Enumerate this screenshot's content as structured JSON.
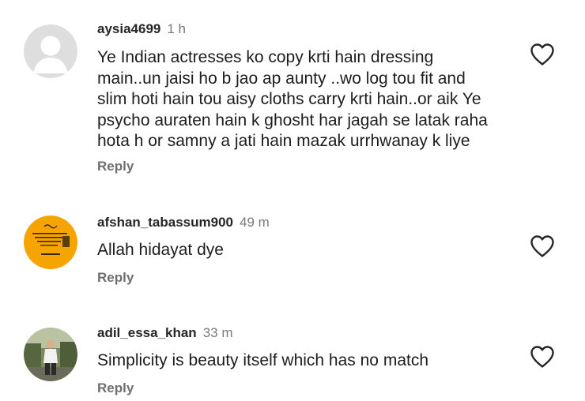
{
  "comments": [
    {
      "username": "aysia4699",
      "time": "1 h",
      "text_lines": [
        "Ye Indian actresses ko copy krti hain dressing",
        "main..un jaisi ho b jao ap aunty ..wo log tou fit and",
        "slim hoti hain tou aisy cloths carry krti hain..or aik Ye",
        "psycho auraten hain k ghosht har jagah se latak raha",
        "hota h or samny a jati hain mazak urrhwanay k liye"
      ],
      "reply_label": "Reply",
      "avatar_icon": "default-user-icon",
      "like_icon": "heart-outline-icon"
    },
    {
      "username": "afshan_tabassum900",
      "time": "49 m",
      "text": "Allah hidayat dye",
      "reply_label": "Reply",
      "avatar_icon": "calligraphy-avatar",
      "like_icon": "heart-outline-icon"
    },
    {
      "username": "adil_essa_khan",
      "time": "33 m",
      "text": "Simplicity is beauty itself which has no match",
      "reply_label": "Reply",
      "avatar_icon": "photo-avatar",
      "like_icon": "heart-outline-icon"
    }
  ],
  "colors": {
    "text": "#1d1d1d",
    "username": "#262626",
    "secondary": "#7a7a7a",
    "avatar_orange": "#f5a400",
    "avatar_grey": "#dedede"
  }
}
